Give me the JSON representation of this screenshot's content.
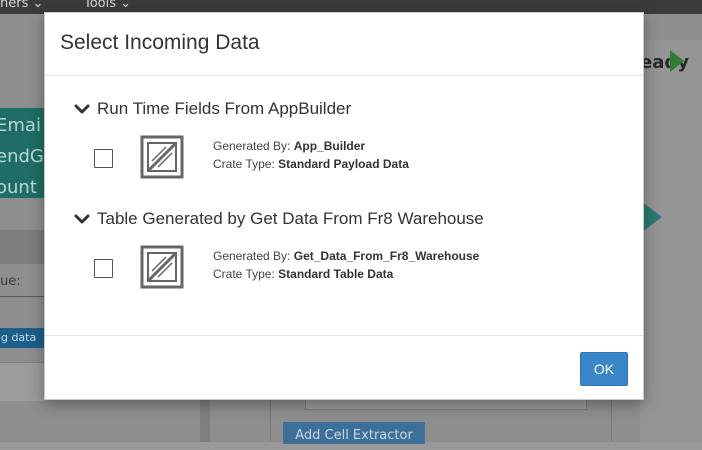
{
  "background": {
    "menus": [
      "ners",
      "Tools"
    ],
    "ready_text": "eady",
    "side_lines": [
      "Emai",
      "endG",
      "ount"
    ],
    "value_label": "ue:",
    "incoming_badge": "ng data",
    "add_button": "Add Cell Extractor"
  },
  "modal": {
    "title": "Select Incoming Data",
    "sections": [
      {
        "label": "Run Time Fields From AppBuilder",
        "generated_by_label": "Generated By:",
        "generated_by": "App_Builder",
        "crate_type_label": "Crate Type:",
        "crate_type": "Standard Payload Data",
        "checked": false
      },
      {
        "label": "Table Generated by Get Data From Fr8 Warehouse",
        "generated_by_label": "Generated By:",
        "generated_by": "Get_Data_From_Fr8_Warehouse",
        "crate_type_label": "Crate Type:",
        "crate_type": "Standard Table Data",
        "checked": false
      }
    ],
    "ok_label": "OK"
  },
  "colors": {
    "primary_button": "#3a86c8",
    "overlay": "#8e8e8e",
    "teal_panel": "#1f6d66"
  }
}
